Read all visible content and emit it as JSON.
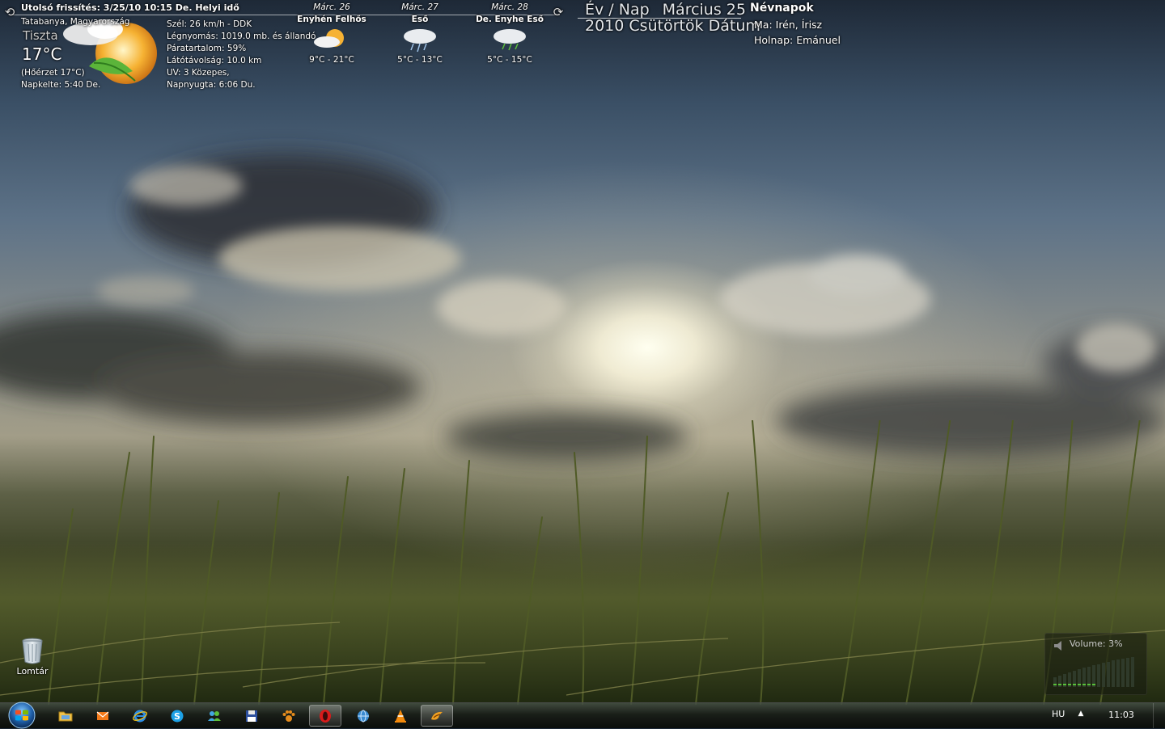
{
  "weather": {
    "last_updated": "Utolsó frissítés: 3/25/10 10:15 De. Helyi idő",
    "location": "Tatabanya, Magyarország",
    "condition": "Tiszta",
    "temperature": "17°C",
    "feels_like": "(Hőérzet 17°C)",
    "sunrise": "Napkelte: 5:40 De.",
    "details": {
      "wind": "Szél: 26 km/h - DDK",
      "pressure": "Légnyomás: 1019.0 mb. és állandó",
      "humidity": "Páratartalom: 59%",
      "visibility": "Látótávolság: 10.0 km",
      "uv": "UV: 3 Közepes,",
      "sunset": "Napnyugta: 6:06 Du."
    },
    "forecast": [
      {
        "day": "Márc. 26",
        "desc": "Enyhén Felhős",
        "range": "9°C - 21°C",
        "icon": "partly-cloudy-icon"
      },
      {
        "day": "Márc. 27",
        "desc": "Eső",
        "range": "5°C - 13°C",
        "icon": "rain-icon"
      },
      {
        "day": "Márc. 28",
        "desc": "De. Enyhe Eső",
        "range": "5°C - 15°C",
        "icon": "light-rain-icon"
      }
    ]
  },
  "date_widget": {
    "year_label": "Év / Nap",
    "month_day": "Március 25",
    "year": "2010",
    "weekday": "Csütörtök",
    "date_label": "Dátum"
  },
  "namedays": {
    "title": "Névnapok",
    "today": "Ma:  Irén, Írisz",
    "tomorrow": "Holnap:  Emánuel"
  },
  "desktop": {
    "recycle_bin_label": "Lomtár"
  },
  "volume": {
    "label": "Volume: 3%",
    "level_percent": 3
  },
  "taskbar": {
    "items": [
      {
        "name": "explorer",
        "icon": "folder-icon",
        "active": false
      },
      {
        "name": "mail",
        "icon": "mail-icon",
        "active": false
      },
      {
        "name": "internet-explorer",
        "icon": "ie-icon",
        "active": false
      },
      {
        "name": "skype",
        "icon": "skype-icon",
        "active": false
      },
      {
        "name": "messenger",
        "icon": "messenger-icon",
        "active": false
      },
      {
        "name": "save",
        "icon": "floppy-icon",
        "active": false
      },
      {
        "name": "gadget",
        "icon": "paw-icon",
        "active": false
      },
      {
        "name": "opera",
        "icon": "opera-icon",
        "active": true
      },
      {
        "name": "icq",
        "icon": "globe-icon",
        "active": false
      },
      {
        "name": "vlc",
        "icon": "vlc-cone-icon",
        "active": false
      },
      {
        "name": "winamp",
        "icon": "winamp-icon",
        "active": true
      }
    ],
    "language": "HU",
    "clock": "11:03"
  },
  "colors": {
    "accent_green": "#4caf2f",
    "opera_red": "#d81b1b",
    "vlc_orange": "#f48a0c"
  }
}
